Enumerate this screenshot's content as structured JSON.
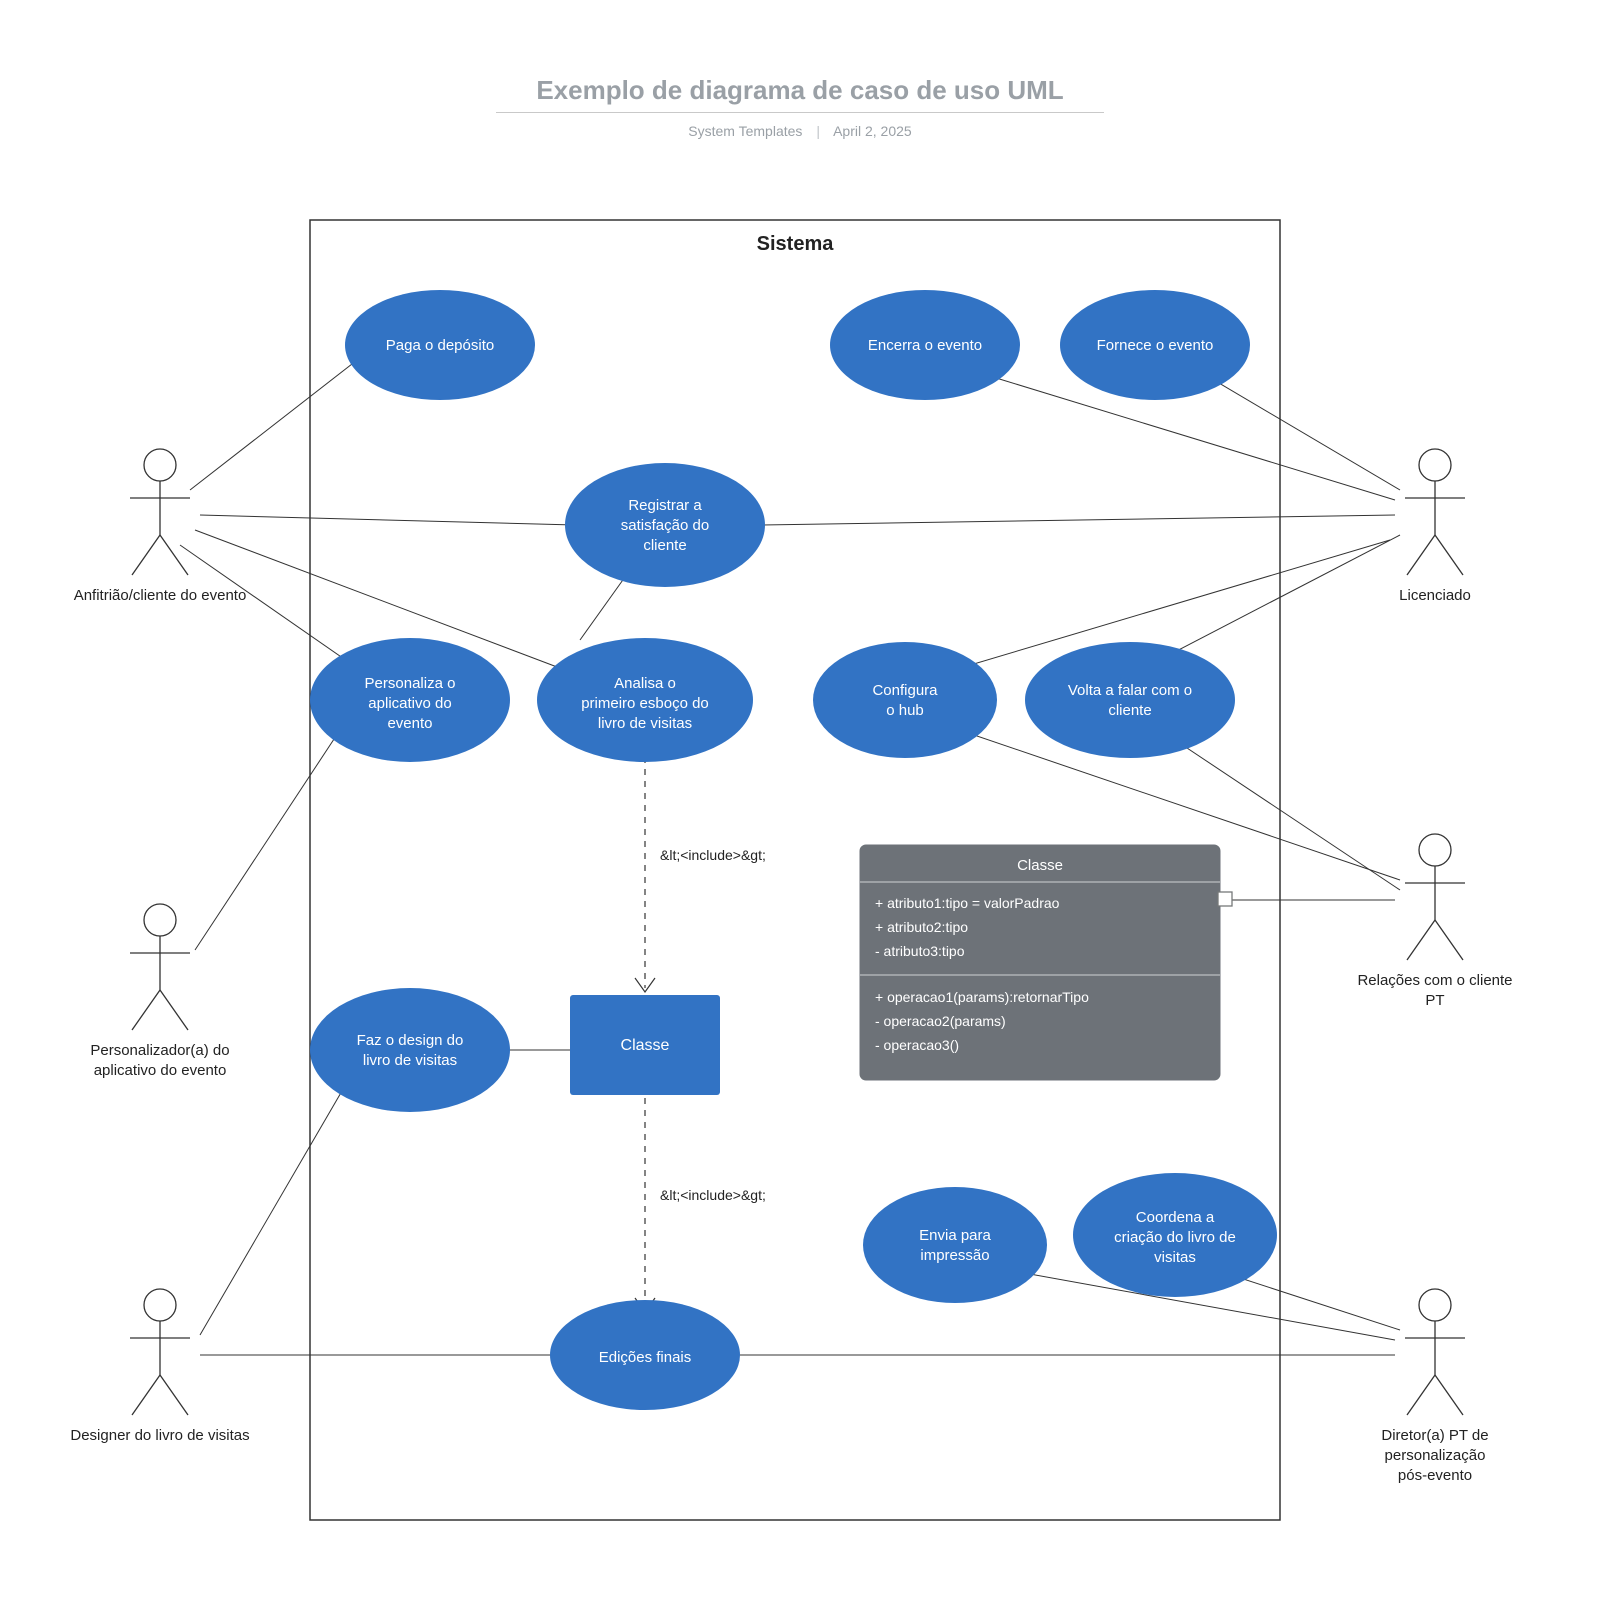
{
  "header": {
    "title": "Exemplo de diagrama de caso de uso UML",
    "author": "System Templates",
    "date": "April 2, 2025"
  },
  "system": {
    "label": "Sistema"
  },
  "usecases": {
    "pay_deposit": "Paga o depósito",
    "close_event": "Encerra o evento",
    "provide_event": "Fornece o evento",
    "register_satisfaction": "Registrar a satisfação do cliente",
    "personalize_app": "Personaliza o aplicativo do evento",
    "analyze_draft": "Analisa o primeiro esboço do livro de visitas",
    "configure_hub": "Configura o hub",
    "talk_again": "Volta a falar com o cliente",
    "design_guestbook": "Faz o design do livro de visitas",
    "send_print": "Envia para impressão",
    "coordinate_book": "Coordena a criação do livro de visitas",
    "final_editions": "Edições finais"
  },
  "include_label": "&lt;<include>&gt;",
  "class_rect_label": "Classe",
  "class_box": {
    "title": "Classe",
    "attrs": [
      "+ atributo1:tipo = valorPadrao",
      "+ atributo2:tipo",
      "- atributo3:tipo"
    ],
    "ops": [
      "+ operacao1(params):retornarTipo",
      "- operacao2(params)",
      "- operacao3()"
    ]
  },
  "actors": {
    "host": "Anfitrião/cliente do evento",
    "licensee": "Licenciado",
    "personalizer_l1": "Personalizador(a) do",
    "personalizer_l2": "aplicativo do evento",
    "relations_l1": "Relações com o cliente",
    "relations_l2": "PT",
    "designer": "Designer do livro de visitas",
    "director_l1": "Diretor(a) PT de",
    "director_l2": "personalização",
    "director_l3": "pós-evento"
  }
}
